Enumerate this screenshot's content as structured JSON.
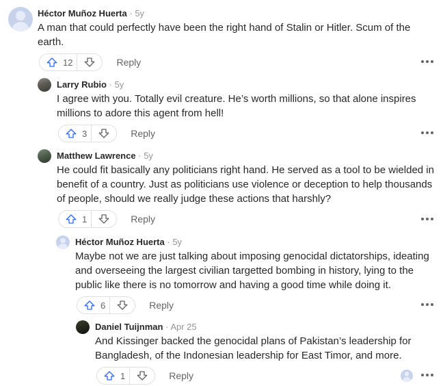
{
  "comments": [
    {
      "author": "Héctor Muñoz Huerta",
      "time": "5y",
      "text": "A man that could perfectly have been the right hand of Stalin or Hitler. Scum of the earth.",
      "upvotes": "12",
      "reply_label": "Reply",
      "avatar": "default-avatar"
    },
    {
      "author": "Larry Rubio",
      "time": "5y",
      "text": "I agree with you. Totally evil creature. He’s worth millions, so that alone inspires millions to adore this agent from hell!",
      "upvotes": "3",
      "reply_label": "Reply",
      "avatar": "photo-avatar"
    },
    {
      "author": "Matthew Lawrence",
      "time": "5y",
      "text": "He could fit basically any politicians right hand. He served as a tool to be wielded in benefit of a country. Just as politicians use violence or deception to help thousands of people, should we really judge these actions that harshly?",
      "upvotes": "1",
      "reply_label": "Reply",
      "avatar": "photo-avatar"
    },
    {
      "author": "Héctor Muñoz Huerta",
      "time": "5y",
      "text": "Maybe not we are just talking about imposing genocidal dictatorships, ideating and overseeing the largest civilian targetted bombing in history, lying to the public like there is no tomorrow and having a good time while doing it.",
      "upvotes": "6",
      "reply_label": "Reply",
      "avatar": "default-avatar"
    },
    {
      "author": "Daniel Tuijnman",
      "time": "Apr 25",
      "text": "And Kissinger backed the genocidal plans of Pakistan’s leadership for Bangladesh, of the Indonesian leadership for East Timor, and more.",
      "upvotes": "1",
      "reply_label": "Reply",
      "avatar": "photo-avatar"
    }
  ],
  "separator": "·",
  "colors": {
    "upvote": "#2e69ff",
    "text": "#282829",
    "muted": "#636466",
    "meta": "#939598"
  }
}
